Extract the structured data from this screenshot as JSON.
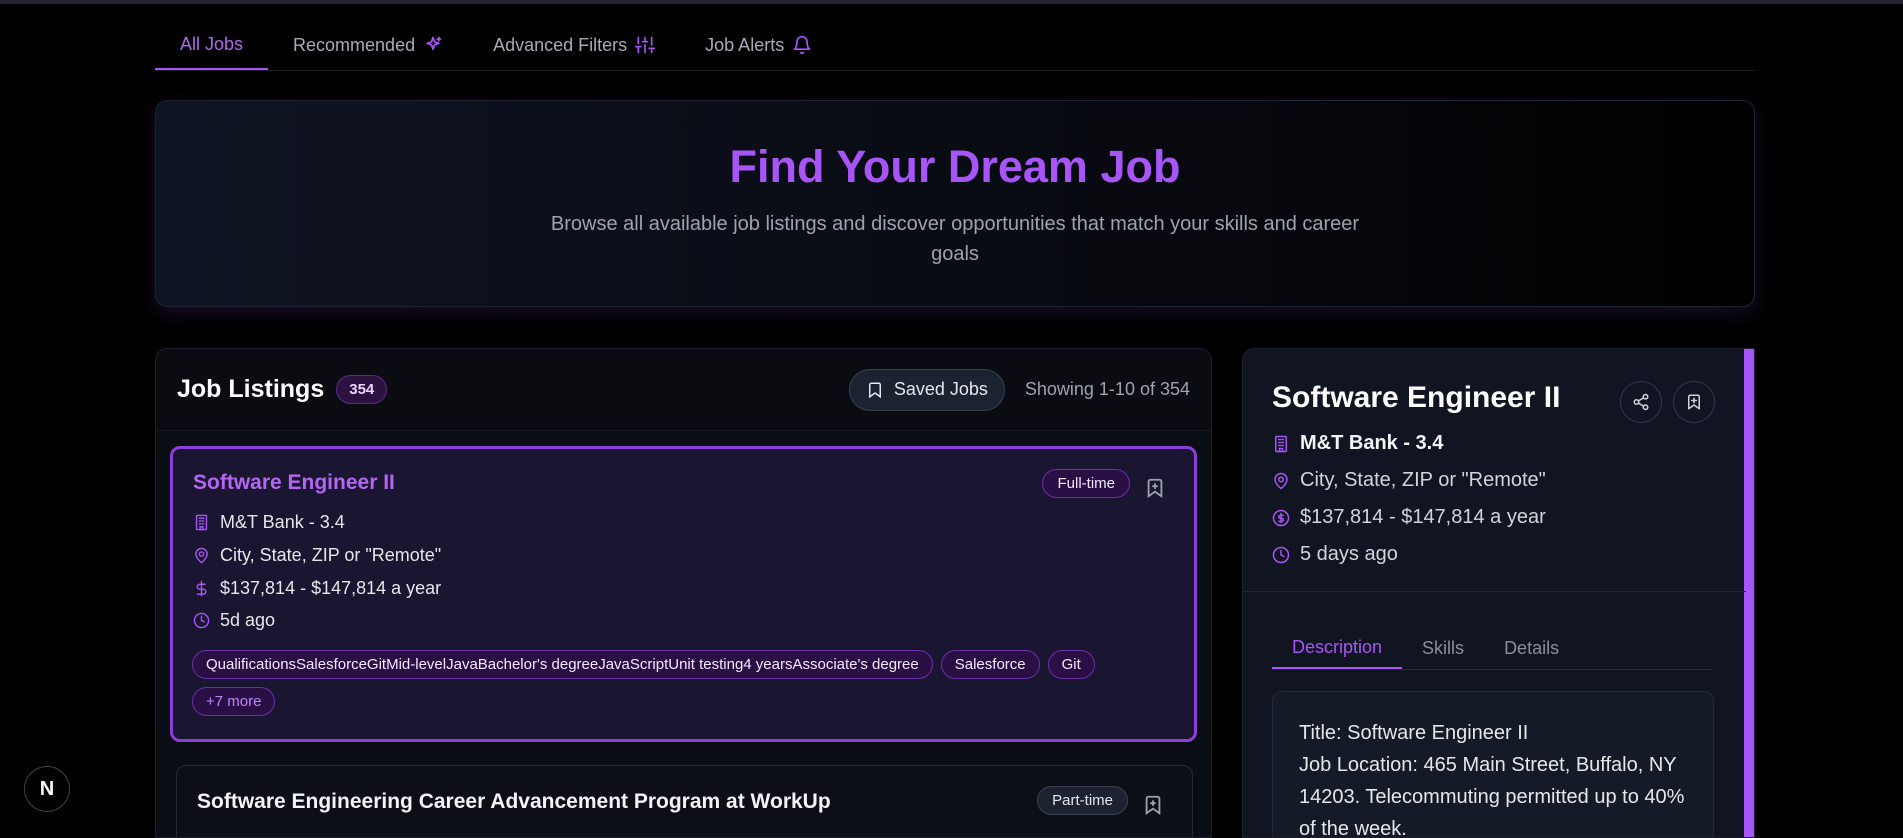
{
  "tabs": [
    {
      "label": "All Jobs",
      "icon": ""
    },
    {
      "label": "Recommended",
      "icon": "sparkles-icon"
    },
    {
      "label": "Advanced Filters",
      "icon": "sliders-icon"
    },
    {
      "label": "Job Alerts",
      "icon": "bell-icon"
    }
  ],
  "hero": {
    "title": "Find Your Dream Job",
    "subtitle": "Browse all available job listings and discover opportunities that match your skills and career goals"
  },
  "listings": {
    "heading": "Job Listings",
    "count": "354",
    "saved_label": "Saved Jobs",
    "showing": "Showing 1-10 of 354",
    "jobs": [
      {
        "title": "Software Engineer II",
        "type": "Full-time",
        "company": "M&T Bank - 3.4",
        "location": "City, State, ZIP or \"Remote\"",
        "salary": "$137,814 - $147,814 a year",
        "posted": "5d ago",
        "tags": [
          "QualificationsSalesforceGitMid-levelJavaBachelor's degreeJavaScriptUnit testing4 yearsAssociate's degree",
          "Salesforce",
          "Git"
        ],
        "more": "+7 more"
      },
      {
        "title": "Software Engineering Career Advancement Program at WorkUp",
        "type": "Part-time"
      }
    ]
  },
  "detail": {
    "title": "Software Engineer II",
    "company": "M&T Bank - 3.4",
    "location": "City, State, ZIP or \"Remote\"",
    "salary": "$137,814 - $147,814 a year",
    "posted": "5 days ago",
    "tabs": [
      "Description",
      "Skills",
      "Details"
    ],
    "description_line1": "Title: Software Engineer II",
    "description_line2": "Job Location: 465 Main Street, Buffalo, NY 14203. Telecommuting permitted up to 40% of the week."
  },
  "next_badge": "N",
  "colors": {
    "accent": "#a855f7",
    "background": "#000000"
  }
}
